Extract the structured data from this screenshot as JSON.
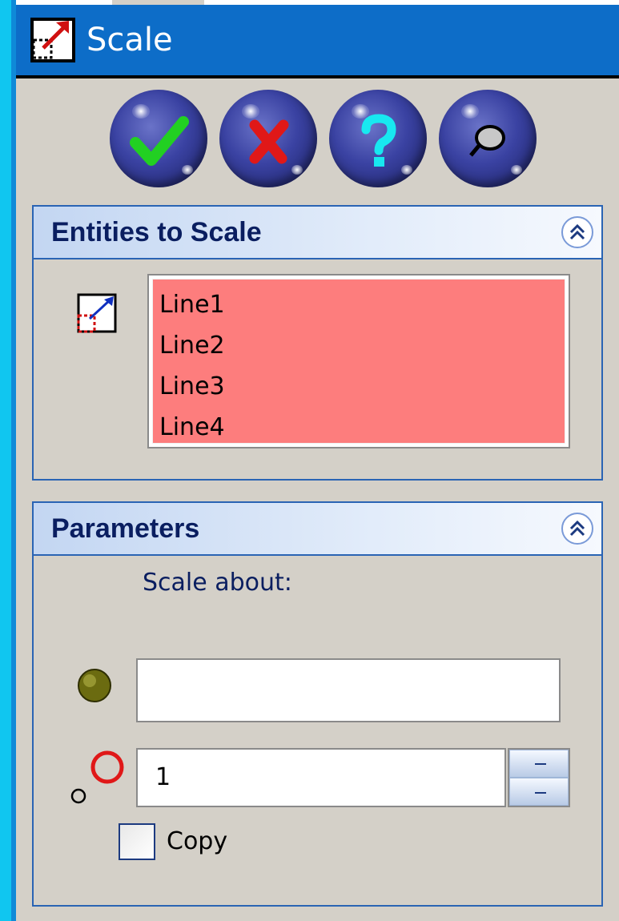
{
  "window": {
    "title": "Scale"
  },
  "actions": [
    {
      "name": "ok-button",
      "icon": "checkmark-icon"
    },
    {
      "name": "cancel-button",
      "icon": "x-icon"
    },
    {
      "name": "help-button",
      "icon": "question-icon"
    },
    {
      "name": "pin-button",
      "icon": "pushpin-icon"
    }
  ],
  "entities_panel": {
    "title": "Entities to Scale",
    "items": [
      "Line1",
      "Line2",
      "Line3",
      "Line4"
    ],
    "list_color": "#fd7d7d"
  },
  "parameters_panel": {
    "title": "Parameters",
    "scale_about_label": "Scale about:",
    "point_value": "",
    "scale_factor": "1",
    "copy_label": "Copy",
    "copy_checked": false
  },
  "colors": {
    "title_bar": "#0d6dc8",
    "panel_border": "#2a64b4",
    "panel_title": "#0a1e60",
    "background": "#d4d0c8"
  }
}
